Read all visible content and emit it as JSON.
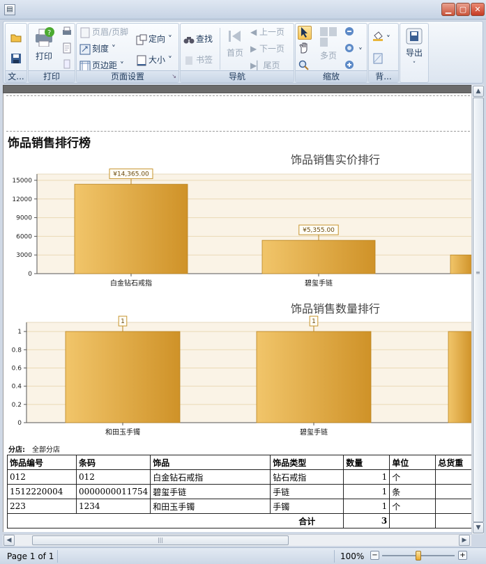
{
  "window": {
    "icon": "document-icon",
    "min": "minimize-icon",
    "max": "maximize-icon",
    "close": "close-icon"
  },
  "ribbon": {
    "groups": {
      "file": "文...",
      "print": "打印",
      "page_setup": "页面设置",
      "navigation": "导航",
      "zoom": "缩放",
      "background": "背...",
      "export": ""
    },
    "print_label": "打印",
    "header_footer": "页眉/页脚",
    "scale": "刻度",
    "margins": "页边距",
    "orientation": "定向",
    "size": "大小",
    "find": "查找",
    "bookmark": "书签",
    "first_page": "首页",
    "prev_page": "上一页",
    "next_page": "下一页",
    "last_page": "尾页",
    "multi_page": "多页",
    "export": "导出"
  },
  "report": {
    "title": "饰品销售排行榜",
    "filter_label": "分店:",
    "filter_value": "全部分店",
    "table": {
      "headers": [
        "饰品编号",
        "条码",
        "饰品",
        "饰品类型",
        "数量",
        "单位",
        "总货重"
      ],
      "rows": [
        [
          "012",
          "012",
          "白金钻石戒指",
          "钻石戒指",
          "1",
          "个",
          ""
        ],
        [
          "1512220004",
          "0000000011754",
          "碧玺手链",
          "手链",
          "1",
          "条",
          ""
        ],
        [
          "223",
          "1234",
          "和田玉手镯",
          "手镯",
          "1",
          "个",
          ""
        ]
      ],
      "total_label": "合计",
      "total_value": "3"
    }
  },
  "chart_data": [
    {
      "type": "bar",
      "title": "饰品销售实价排行",
      "categories": [
        "白金钻石戒指",
        "碧玺手链",
        ""
      ],
      "values": [
        14365,
        5355,
        3000
      ],
      "data_labels": [
        "¥14,365.00",
        "¥5,355.00",
        ""
      ],
      "ylim": [
        0,
        16000
      ],
      "yticks": [
        "0",
        "3000",
        "6000",
        "9000",
        "12000",
        "15000"
      ]
    },
    {
      "type": "bar",
      "title": "饰品销售数量排行",
      "categories": [
        "和田玉手镯",
        "碧玺手链",
        ""
      ],
      "values": [
        1,
        1,
        1
      ],
      "data_labels": [
        "1",
        "1",
        ""
      ],
      "ylim": [
        0,
        1.1
      ],
      "yticks": [
        "0",
        "0.2",
        "0.4",
        "0.6",
        "0.8",
        "1"
      ]
    }
  ],
  "status": {
    "page_text": "Page 1 of 1",
    "zoom": "100%"
  },
  "colors": {
    "bar_light": "#f1c56a",
    "bar_dark": "#cf9228",
    "plot_bg": "#faf3e6"
  }
}
